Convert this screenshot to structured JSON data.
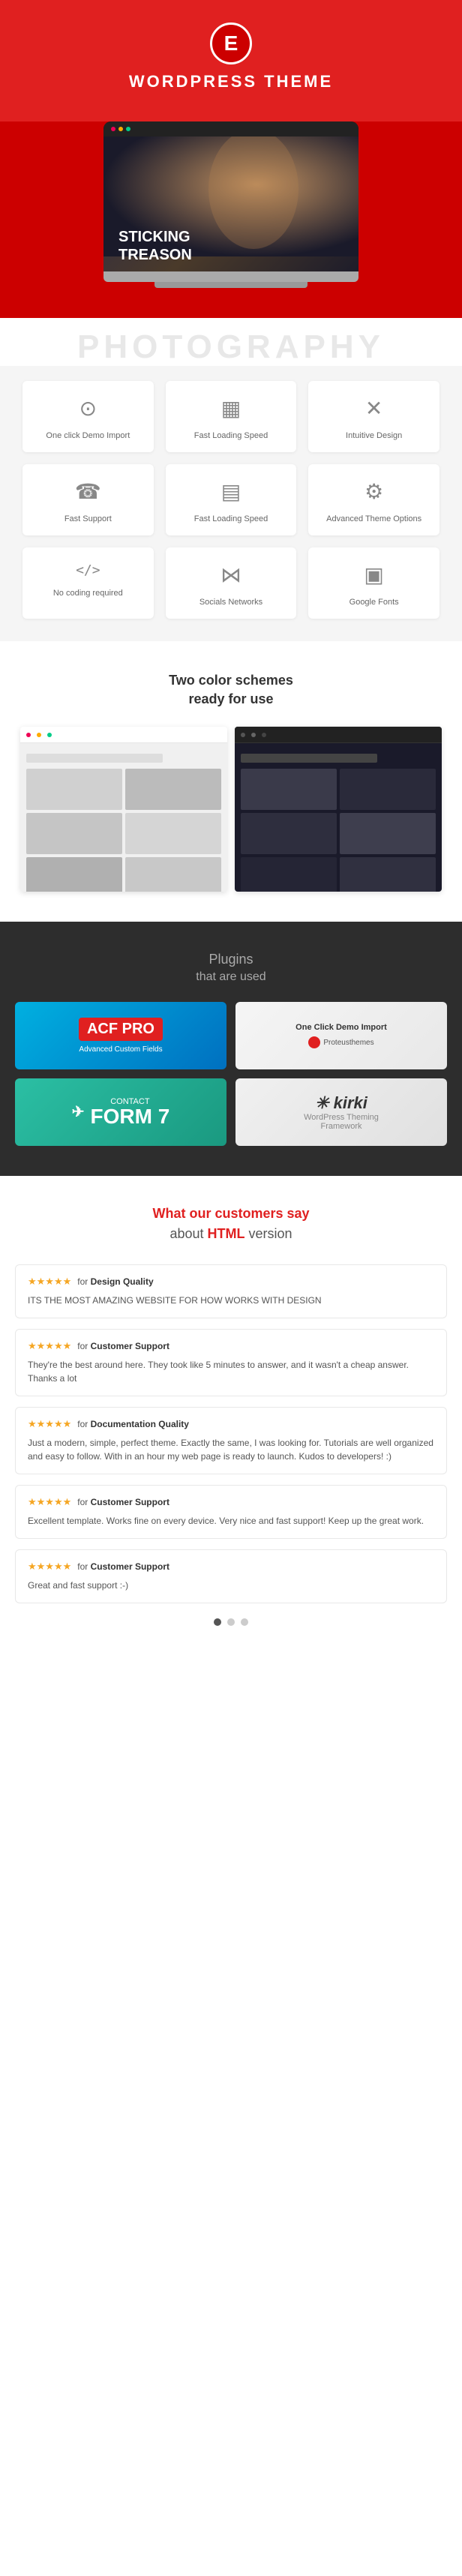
{
  "header": {
    "logo_letter": "E",
    "title": "WORDPRESS THEME"
  },
  "hero": {
    "overlay_line1": "STICKING",
    "overlay_line2": "TREASON"
  },
  "photo_text": "PHOTOGRAPHY",
  "features": [
    {
      "id": "one-click-demo",
      "icon": "⊙",
      "label": "One click Demo Import"
    },
    {
      "id": "fast-loading-1",
      "icon": "▦",
      "label": "Fast Loading Speed"
    },
    {
      "id": "intuitive-design",
      "icon": "✕",
      "label": "Intuitive Design"
    },
    {
      "id": "fast-support",
      "icon": "☎",
      "label": "Fast Support"
    },
    {
      "id": "fast-loading-2",
      "icon": "▤",
      "label": "Fast Loading Speed"
    },
    {
      "id": "advanced-theme",
      "icon": "⚙",
      "label": "Advanced Theme Options"
    },
    {
      "id": "no-coding",
      "icon": "</>",
      "label": "No coding required"
    },
    {
      "id": "socials",
      "icon": "⋈",
      "label": "Socials Networks"
    },
    {
      "id": "google-fonts",
      "icon": "▣",
      "label": "Google Fonts"
    }
  ],
  "color_schemes": {
    "title_line1": "Two color schemes",
    "title_line2": "ready for use"
  },
  "plugins": {
    "title_line1": "Plugins",
    "title_line2": "that are used",
    "items": [
      {
        "id": "acf-pro",
        "label": "ACF PRO"
      },
      {
        "id": "one-click-demo-import",
        "label": "One Click Demo Import"
      },
      {
        "id": "contact-form-7",
        "label": "CONTACT FORM 7"
      },
      {
        "id": "kirki",
        "label": "kirki"
      }
    ]
  },
  "testimonials": {
    "title_plain": "What our customers say",
    "title_line2_plain": "about ",
    "title_html_word": "HTML",
    "title_line2_end": " version",
    "reviews": [
      {
        "stars": "★★★★★",
        "for_label": "for",
        "category": "Design Quality",
        "text": "ITS THE MOST AMAZING WEBSITE FOR HOW WORKS WITH DESIGN"
      },
      {
        "stars": "★★★★★",
        "for_label": "for",
        "category": "Customer Support",
        "text": "They're the best around here. They took like 5 minutes to answer, and it wasn't a cheap answer. Thanks a lot"
      },
      {
        "stars": "★★★★★",
        "for_label": "for",
        "category": "Documentation Quality",
        "text": "Just a modern, simple, perfect theme. Exactly the same, I was looking for. Tutorials are well organized and easy to follow. With in an hour my web page is ready to launch. Kudos to developers! :)"
      },
      {
        "stars": "★★★★★",
        "for_label": "for",
        "category": "Customer Support",
        "text": "Excellent template. Works fine on every device. Very nice and fast support! Keep up the great work."
      },
      {
        "stars": "★★★★★",
        "for_label": "for",
        "category": "Customer Support",
        "text": "Great and fast support :-)"
      }
    ]
  },
  "pagination": {
    "dots": [
      true,
      false,
      false
    ]
  }
}
